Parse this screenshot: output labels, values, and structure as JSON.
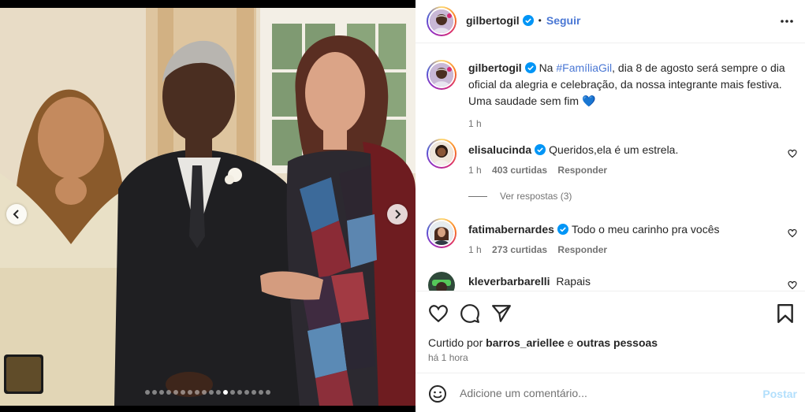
{
  "post": {
    "username": "gilbertogil",
    "follow_label": "Seguir",
    "separator": "•",
    "caption": {
      "username": "gilbertogil",
      "prefix": "Na ",
      "hashtag": "#FamíliaGil",
      "text": ", dia 8 de agosto será sempre o dia oficial da alegria e celebração, da nossa integrante mais festiva. Uma saudade sem fim ",
      "emoji": "💙",
      "time": "1 h"
    }
  },
  "comments": [
    {
      "username": "elisalucinda",
      "verified": true,
      "text": "Queridos,ela é um estrela.",
      "time": "1 h",
      "likes": "403 curtidas",
      "reply_label": "Responder"
    },
    {
      "username": "fatimabernardes",
      "verified": true,
      "text": "Todo o meu carinho pra vocês",
      "time": "1 h",
      "likes": "273 curtidas",
      "reply_label": "Responder"
    },
    {
      "username": "kleverbarbarelli",
      "verified": false,
      "text": "Rapais"
    }
  ],
  "view_replies_label": "Ver respostas (3)",
  "liked_by": {
    "prefix": "Curtido por ",
    "user": "barros_ariellee",
    "middle": " e ",
    "others": "outras pessoas"
  },
  "posted_time": "há 1 hora",
  "add_comment": {
    "placeholder": "Adicione um comentário...",
    "post_label": "Postar"
  },
  "carousel": {
    "total": 18,
    "active_index": 11
  },
  "icons": {
    "verified": "verified-badge-icon",
    "more": "more-horizontal-icon",
    "like": "heart-icon",
    "comment": "comment-bubble-icon",
    "share": "paper-plane-icon",
    "save": "bookmark-icon",
    "emoji": "smiley-icon",
    "prev": "chevron-left-icon",
    "next": "chevron-right-icon"
  },
  "colors": {
    "link_blue": "#4a77d4",
    "verified_blue": "#0095f6",
    "muted_text": "#737373",
    "post_disabled": "#b2dffc"
  }
}
